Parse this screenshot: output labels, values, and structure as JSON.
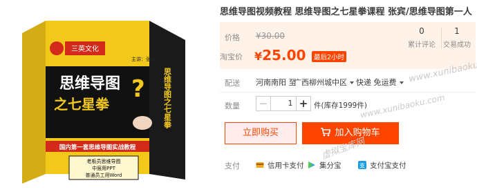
{
  "product": {
    "title": "思维导图视频教程 思维导图之七星拳课程 张宾/思维导图第一人",
    "image": {
      "publisher_logo": "三英文化",
      "author": "主讲：张宾",
      "book_title_line1": "思维导图",
      "book_title_line2": "之七星拳",
      "spine_title": "思维导图之七星拳",
      "banner": "国内第一套思维导图实战教程",
      "features": [
        "老板员思维导图",
        "中层用PPT",
        "普通员工用Word"
      ]
    }
  },
  "pricing": {
    "orig_label": "价格",
    "orig_price": "¥30.00",
    "cur_label": "淘宝价",
    "cur_symbol": "¥",
    "cur_value": "25.00",
    "countdown": "最后2小时",
    "reviews_count": "0",
    "reviews_label": "累计评论",
    "sales_count": "1",
    "sales_label": "交易成功"
  },
  "shipping": {
    "label": "配送",
    "from": "河南南阳 至",
    "to": "广西柳州城中区",
    "method": "快递 免运费"
  },
  "quantity": {
    "label": "数量",
    "minus": "−",
    "value": "1",
    "plus": "+",
    "stock": "件(库存1999件)"
  },
  "actions": {
    "buy_now": "立即购买",
    "add_cart": "加入购物车"
  },
  "payment": {
    "label": "支付",
    "methods": [
      "信用卡支付",
      "集分宝",
      "支付宝支付"
    ]
  },
  "watermarks": {
    "site": "www.xunibaoku.com",
    "cn": "虚拟宝库网"
  }
}
